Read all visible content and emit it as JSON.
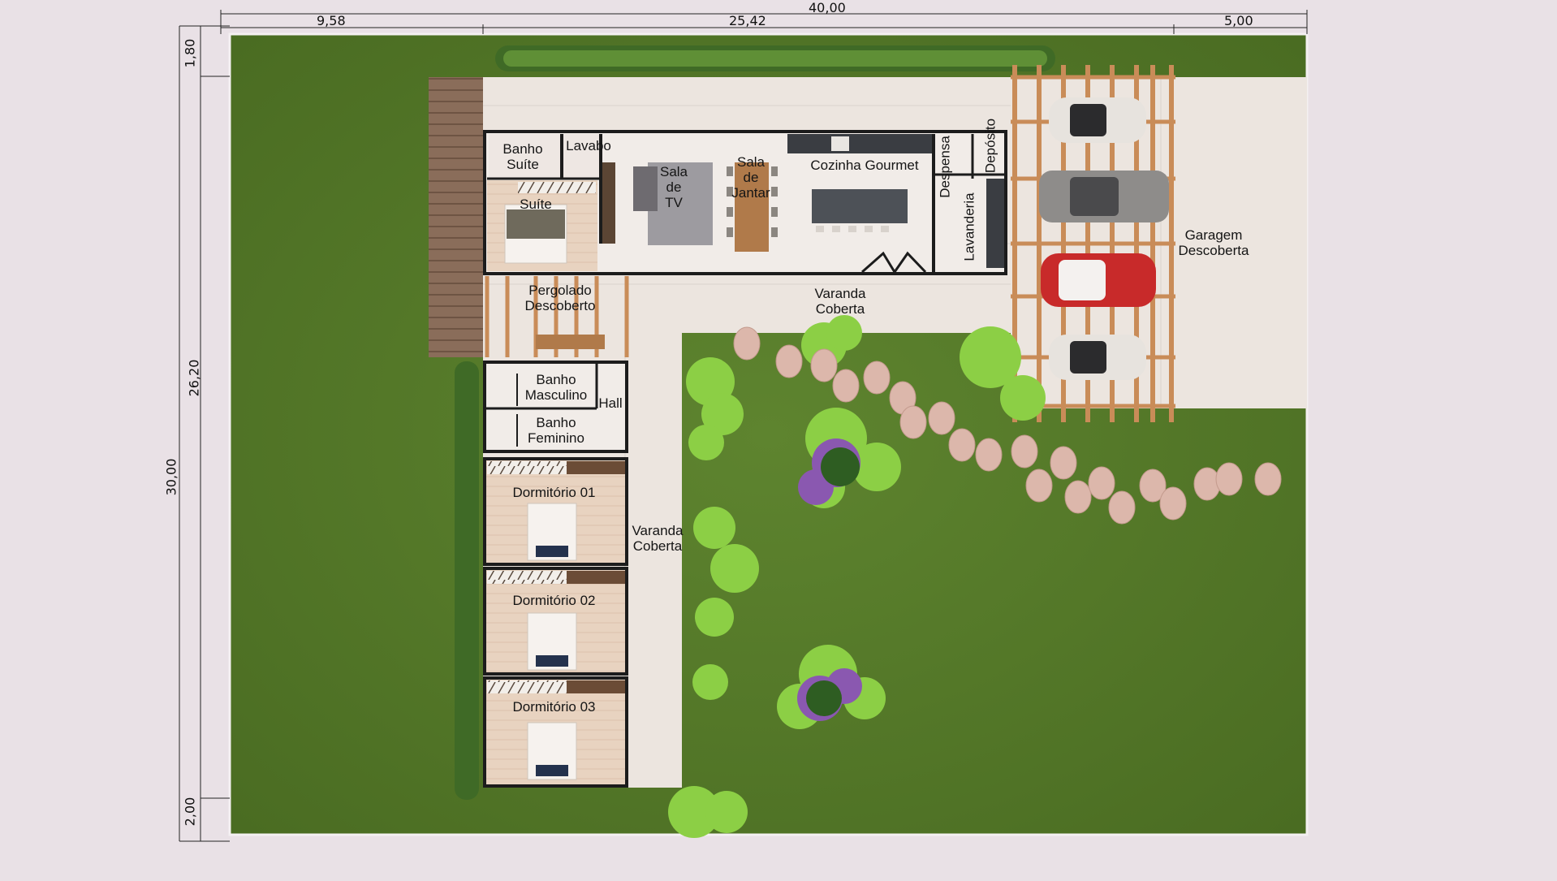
{
  "dimensions": {
    "top_total": "40,00",
    "top_left": "9,58",
    "top_middle": "25,42",
    "top_right": "5,00",
    "side_total": "30,00",
    "side_top": "1,80",
    "side_middle": "26,20",
    "side_bottom": "2,00"
  },
  "rooms": {
    "banho_suite": "Banho\nSuíte",
    "lavabo": "Lavabo",
    "suite": "Suíte",
    "sala_tv": "Sala\nde\nTV",
    "sala_jantar": "Sala\nde\nJantar",
    "cozinha": "Cozinha Gourmet",
    "despensa": "Despensa",
    "deposito": "Depósito",
    "lavanderia": "Lavanderia",
    "garagem": "Garagem\nDescoberta",
    "pergolado": "Pergolado\nDescoberto",
    "varanda_top": "Varanda\nCoberta",
    "banho_masculino": "Banho\nMasculino",
    "hall": "Hall",
    "banho_feminino": "Banho\nFeminino",
    "dormitorio_01": "Dormitório 01",
    "dormitorio_02": "Dormitório 02",
    "dormitorio_03": "Dormitório 03",
    "varanda_side": "Varanda\nCoberta"
  },
  "colors": {
    "background": "#e9e1e6",
    "lawn": "#567a2a",
    "floor": "#ece5df",
    "wall": "#1c1c1c",
    "wood": "#c98c58",
    "deck": "#8a6d5a",
    "stone": "#dcb7ab",
    "shrub": "#8ccf45",
    "lavender": "#8a58b0"
  }
}
